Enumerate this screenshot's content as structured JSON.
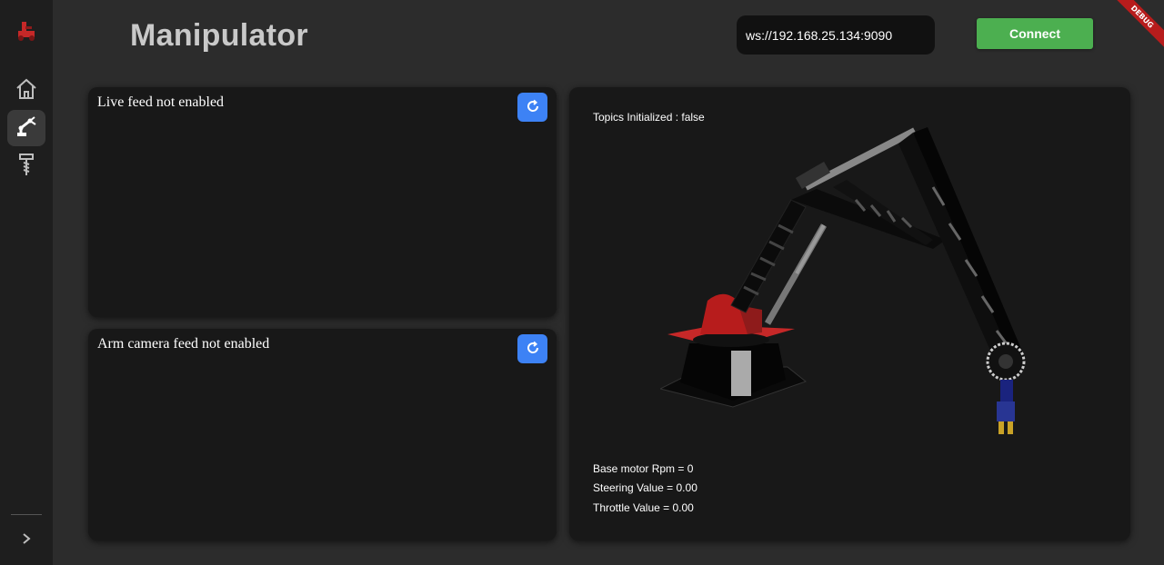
{
  "header": {
    "title": "Manipulator",
    "connection_url": "ws://192.168.25.134:9090",
    "connect_label": "Connect",
    "debug_label": "DEBUG"
  },
  "sidebar": {
    "logo": "rover-logo-icon",
    "items": [
      {
        "icon": "home-icon",
        "active": false
      },
      {
        "icon": "robot-arm-icon",
        "active": true
      },
      {
        "icon": "drill-icon",
        "active": false
      }
    ],
    "expand_icon": "chevron-right-icon"
  },
  "feeds": {
    "live": {
      "alt_text": "Live feed not enabled",
      "refresh_icon": "refresh-icon"
    },
    "arm": {
      "alt_text": "Arm camera feed not enabled",
      "refresh_icon": "refresh-icon"
    }
  },
  "arm_panel": {
    "topics_status": "Topics Initialized : false",
    "base_motor_rpm": "Base motor Rpm = 0",
    "steering_value": "Steering Value = 0.00",
    "throttle_value": "Throttle Value = 0.00"
  },
  "colors": {
    "background": "#2c2c2c",
    "sidebar": "#1e1e1e",
    "panel": "#181818",
    "connect": "#4caf50",
    "refresh": "#3d82f5",
    "debug": "#b71c1c",
    "arm_base_red": "#c62828"
  }
}
